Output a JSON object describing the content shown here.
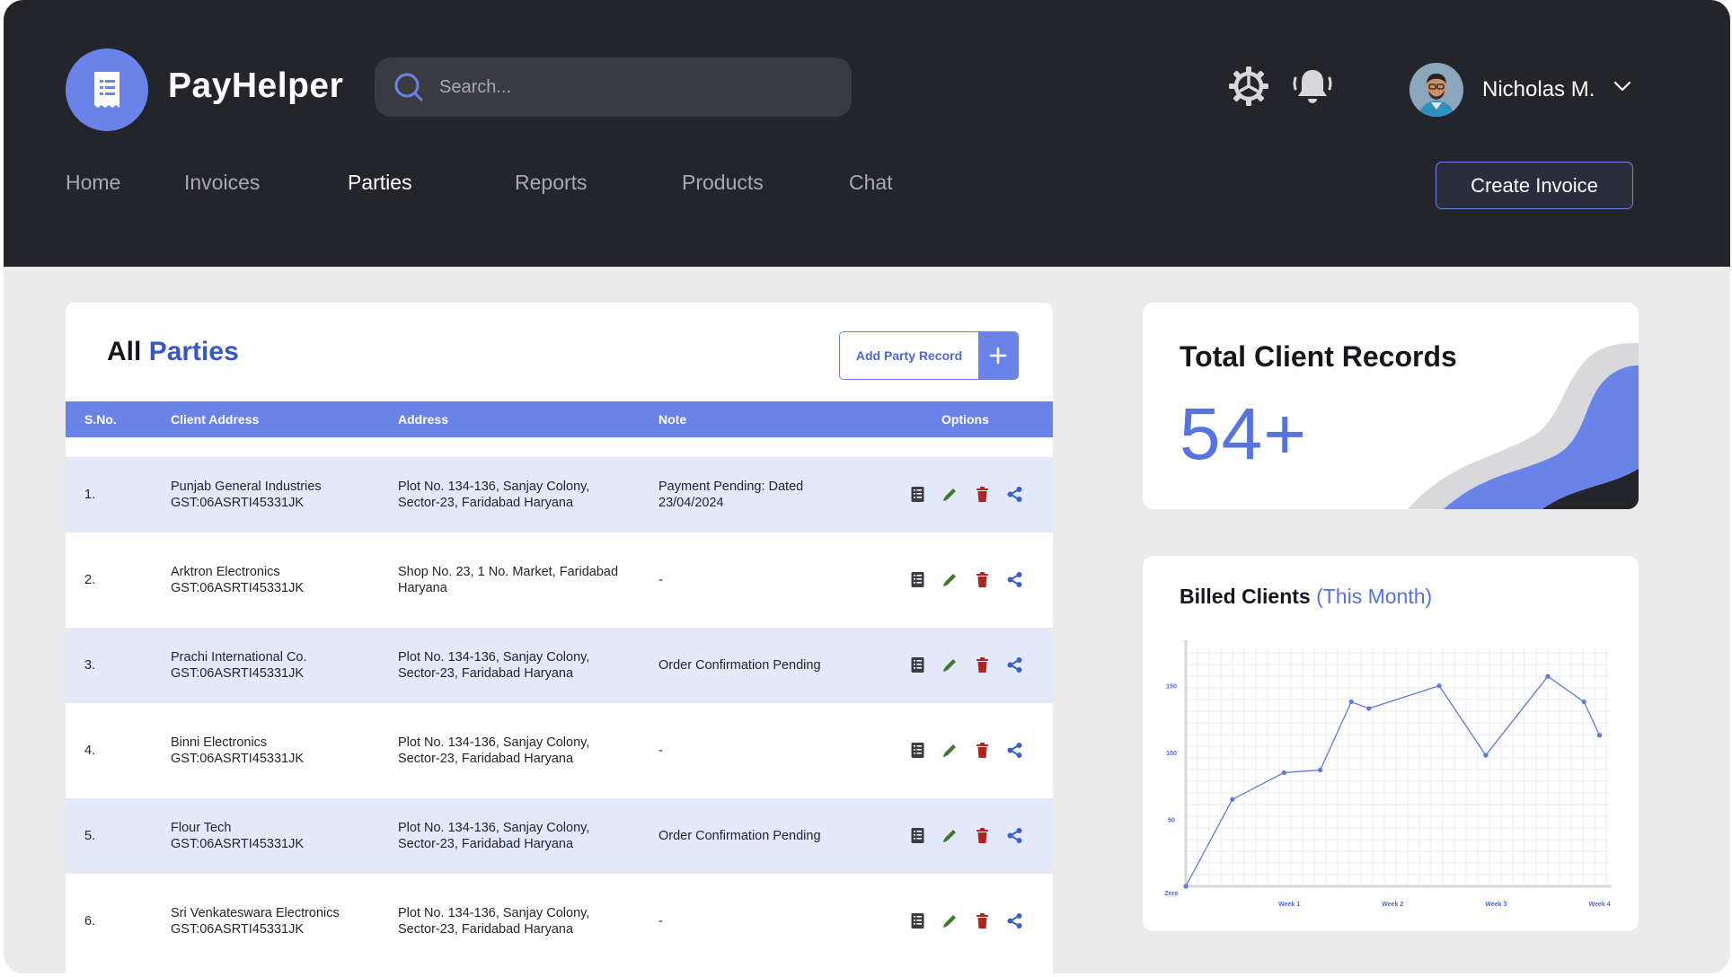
{
  "app": {
    "name": "PayHelper"
  },
  "search": {
    "placeholder": "Search..."
  },
  "user": {
    "name": "Nicholas M."
  },
  "nav": {
    "items": [
      "Home",
      "Invoices",
      "Parties",
      "Reports",
      "Products",
      "Chat"
    ],
    "active": "Parties"
  },
  "create_invoice_label": "Create Invoice",
  "parties": {
    "title_prefix": "All",
    "title_accent": "Parties",
    "add_label": "Add Party Record",
    "columns": [
      "S.No.",
      "Client Address",
      "Address",
      "Note",
      "Options"
    ],
    "rows": [
      {
        "sno": "1.",
        "client": "Punjab General Industries",
        "gst": "GST:06ASRTI45331JK",
        "addr1": "Plot No. 134-136, Sanjay Colony,",
        "addr2": "Sector-23, Faridabad Haryana",
        "note1": "Payment Pending: Dated",
        "note2": "23/04/2024"
      },
      {
        "sno": "2.",
        "client": "Arktron Electronics",
        "gst": "GST:06ASRTI45331JK",
        "addr1": "Shop No. 23, 1 No. Market, Faridabad",
        "addr2": "Haryana",
        "note1": "-",
        "note2": ""
      },
      {
        "sno": "3.",
        "client": "Prachi International Co.",
        "gst": "GST:06ASRTI45331JK",
        "addr1": "Plot No. 134-136, Sanjay Colony,",
        "addr2": "Sector-23, Faridabad Haryana",
        "note1": "Order Confirmation Pending",
        "note2": ""
      },
      {
        "sno": "4.",
        "client": "Binni Electronics",
        "gst": "GST:06ASRTI45331JK",
        "addr1": "Plot No. 134-136, Sanjay Colony,",
        "addr2": "Sector-23, Faridabad Haryana",
        "note1": "-",
        "note2": ""
      },
      {
        "sno": "5.",
        "client": "Flour Tech",
        "gst": "GST:06ASRTI45331JK",
        "addr1": "Plot No. 134-136, Sanjay Colony,",
        "addr2": "Sector-23, Faridabad Haryana",
        "note1": "Order Confirmation Pending",
        "note2": ""
      },
      {
        "sno": "6.",
        "client": "Sri Venkateswara Electronics",
        "gst": "GST:06ASRTI45331JK",
        "addr1": "Plot No. 134-136, Sanjay Colony,",
        "addr2": "Sector-23, Faridabad Haryana",
        "note1": "-",
        "note2": ""
      }
    ]
  },
  "records": {
    "title": "Total Client Records",
    "value": "54+"
  },
  "billed": {
    "title": "Billed Clients",
    "subtitle": "(This Month)"
  },
  "icons": {
    "logo": "receipt-icon",
    "search": "search-icon",
    "settings": "gear-icon",
    "notifications": "bell-icon",
    "user_menu": "chevron-down-icon",
    "add": "plus-icon",
    "row_options": [
      "document-icon",
      "pencil-icon",
      "trash-icon",
      "share-icon"
    ]
  },
  "colors": {
    "accent": "#6a83e8",
    "header_bg": "#24252b",
    "row_alt": "#e3e8fb",
    "edit": "#3f7a2a",
    "delete": "#b3221c"
  },
  "chart_data": {
    "type": "line",
    "title": "Billed Clients",
    "subtitle": "(This Month)",
    "x_ticks": [
      "Week 1",
      "Week 2",
      "Week 3",
      "Week 4"
    ],
    "y_ticks": [
      "Zero",
      "50",
      "100",
      "150"
    ],
    "xlim": [
      0,
      4.1
    ],
    "ylim": [
      0,
      180
    ],
    "grid": true,
    "series": [
      {
        "x": [
          0,
          0.45,
          0.95,
          1.3,
          1.6,
          1.77,
          2.45,
          2.9,
          3.5,
          3.85,
          4.0
        ],
        "y": [
          0,
          65,
          85,
          87,
          138,
          133,
          150,
          98,
          157,
          138,
          113
        ]
      }
    ]
  }
}
